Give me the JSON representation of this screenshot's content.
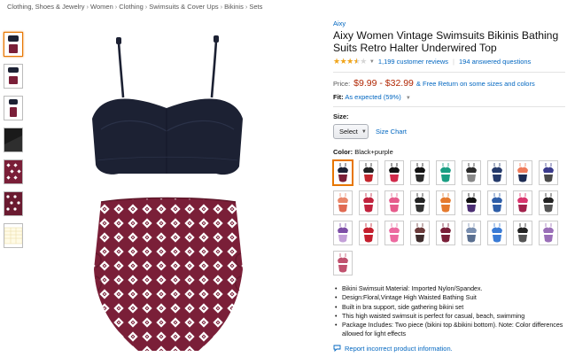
{
  "breadcrumb": [
    "Clothing, Shoes & Jewelry",
    "Women",
    "Clothing",
    "Swimsuits & Cover Ups",
    "Bikinis",
    "Sets"
  ],
  "breadcrumb_separator": "›",
  "product": {
    "brand": "Aixy",
    "title": "Aixy Women Vintage Swimsuits Bikinis Bathing Suits Retro Halter Underwired Top",
    "rating_stars": 3.5,
    "reviews": "1,199 customer reviews",
    "answered": "194 answered questions",
    "price_label": "Price:",
    "price": "$9.99 - $32.99",
    "price_note": "& Free Return on some sizes and colors",
    "fit_label": "Fit:",
    "fit_value": "As expected (59%)",
    "size_label": "Size:",
    "size_select": "Select",
    "size_chart": "Size Chart",
    "color_label": "Color:",
    "color_value": "Black+purple",
    "bullets": [
      "Bikini Swimsuit Material: Imported Nylon/Spandex.",
      "Design:Floral,Vintage High Waisted Bathing Suit",
      "Built in bra support, side gathering bikini set",
      "This high waisted swimsuit is perfect for casual, beach, swimming",
      "Package Includes: Two piece (bikini top &bikini bottom). Note: Color differences allowed for light effects"
    ],
    "report": "Report incorrect product information."
  },
  "thumbnails": [
    "navy-burgundy-set",
    "navy-burgundy-back",
    "navy-burgundy-front",
    "black-fabric-detail",
    "burgundy-print-detail",
    "print-pattern-closeup",
    "size-chart-table"
  ],
  "swatches": [
    {
      "top": "#1c2133",
      "bottom": "#7a1f38",
      "selected": true
    },
    {
      "top": "#222",
      "bottom": "#c3262d"
    },
    {
      "top": "#111",
      "bottom": "#d02a4a"
    },
    {
      "top": "#111",
      "bottom": "#2c2c2c"
    },
    {
      "top": "#1a9e83",
      "bottom": "#1a9e83"
    },
    {
      "top": "#2b2b2b",
      "bottom": "#888"
    },
    {
      "top": "#253a6b",
      "bottom": "#253a6b"
    },
    {
      "top": "#ef7b5a",
      "bottom": "#1d2c53"
    },
    {
      "top": "#3b3b8c",
      "bottom": "#4a4a4a"
    },
    {
      "top": "#e9876a",
      "bottom": "#e06a52"
    },
    {
      "top": "#c1233e",
      "bottom": "#c1233e"
    },
    {
      "top": "#e65c8c",
      "bottom": "#e65c8c"
    },
    {
      "top": "#222",
      "bottom": "#333"
    },
    {
      "top": "#e57a2e",
      "bottom": "#e57a2e"
    },
    {
      "top": "#111",
      "bottom": "#4c2f74"
    },
    {
      "top": "#2f5ea8",
      "bottom": "#2f5ea8"
    },
    {
      "top": "#d9356d",
      "bottom": "#a2214b"
    },
    {
      "top": "#222",
      "bottom": "#555"
    },
    {
      "top": "#7d4ea6",
      "bottom": "#c3a0d8"
    },
    {
      "top": "#c41f2e",
      "bottom": "#c41f2e"
    },
    {
      "top": "#ec6aa0",
      "bottom": "#ec6aa0"
    },
    {
      "top": "#6b3a3a",
      "bottom": "#3f2d2d"
    },
    {
      "top": "#7a1f38",
      "bottom": "#7a1f38"
    },
    {
      "top": "#7a8fb0",
      "bottom": "#5a6f90"
    },
    {
      "top": "#3a7bd5",
      "bottom": "#3a7bd5"
    },
    {
      "top": "#222",
      "bottom": "#555"
    },
    {
      "top": "#9a6fb8",
      "bottom": "#9a6fb8"
    },
    {
      "top": "#c0516e",
      "bottom": "#c0516e"
    }
  ],
  "colors": {
    "link": "#0066c0",
    "price": "#b12704",
    "star": "#f0a41a",
    "selected_border": "#e77600",
    "top_navy": "#1c2133",
    "bottom_burgundy": "#7a1f38"
  }
}
